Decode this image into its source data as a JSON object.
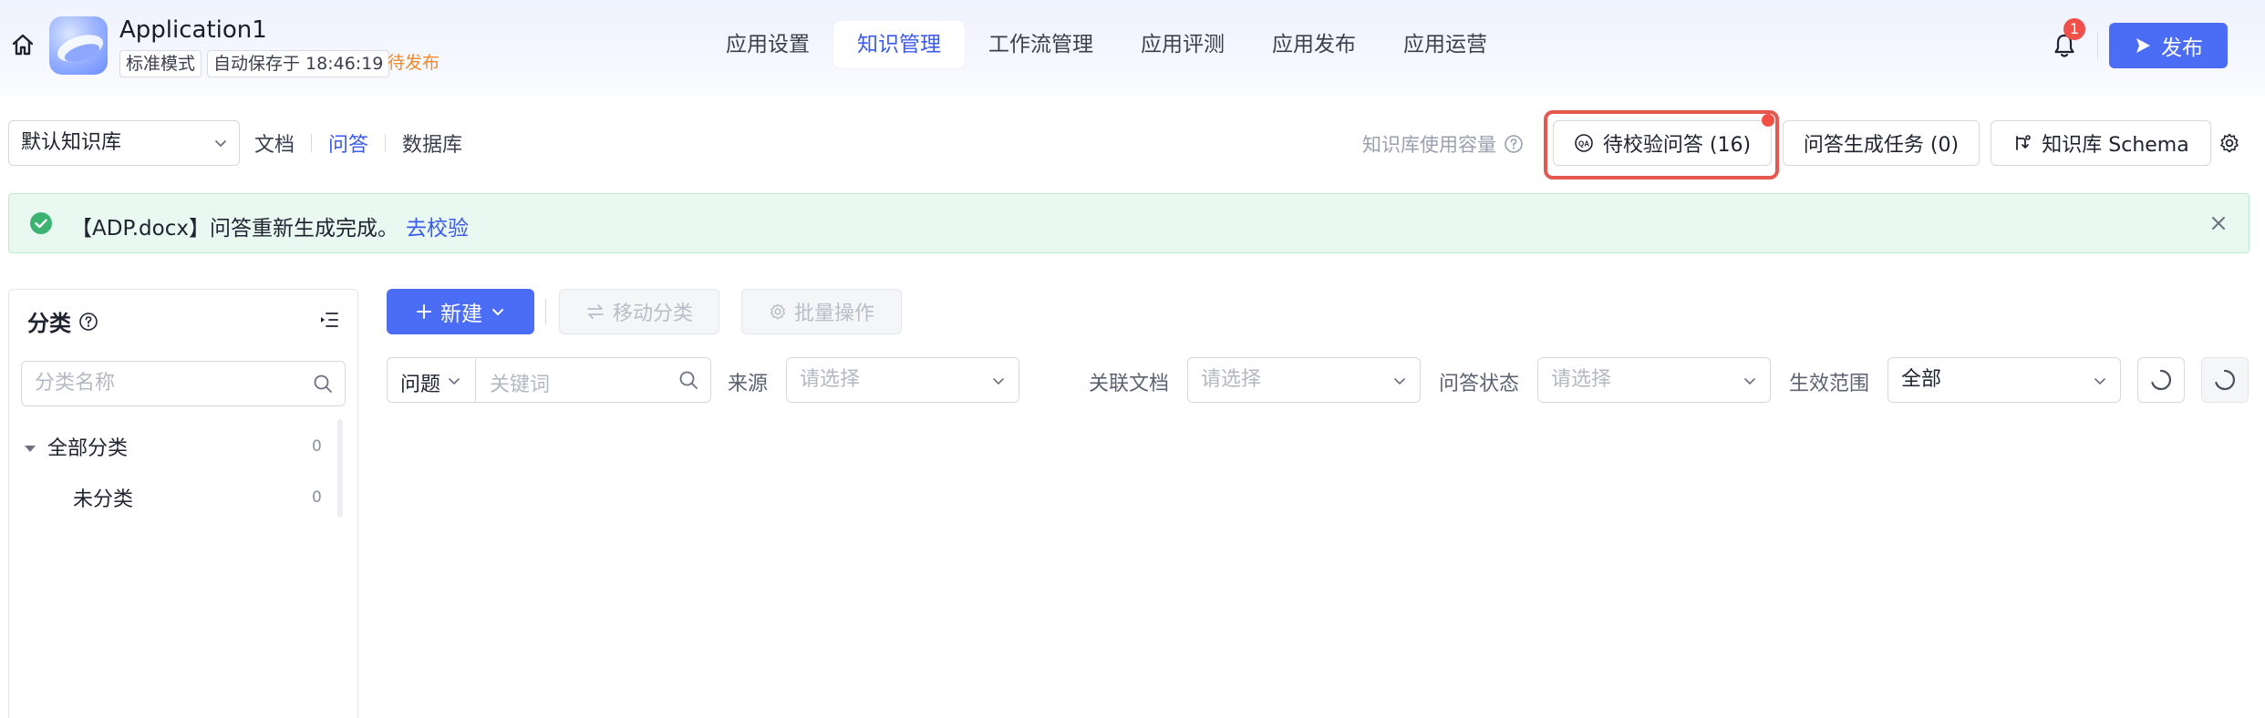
{
  "header": {
    "app_name": "Application1",
    "mode_tag": "标准模式",
    "autosave_tag": "自动保存于 18:46:19",
    "status_tag": "待发布",
    "tabs": [
      {
        "label": "应用设置",
        "active": false
      },
      {
        "label": "知识管理",
        "active": true
      },
      {
        "label": "工作流管理",
        "active": false
      },
      {
        "label": "应用评测",
        "active": false
      },
      {
        "label": "应用发布",
        "active": false
      },
      {
        "label": "应用运营",
        "active": false
      }
    ],
    "notification_count": "1",
    "publish_label": "发布"
  },
  "kb_bar": {
    "selected_kb": "默认知识库",
    "subtabs": [
      {
        "label": "文档",
        "active": false
      },
      {
        "label": "问答",
        "active": true
      },
      {
        "label": "数据库",
        "active": false
      }
    ],
    "capacity_label": "知识库使用容量",
    "pending_button": "待校验问答 (16)",
    "gen_task_button": "问答生成任务 (0)",
    "schema_button": "知识库 Schema"
  },
  "alert": {
    "message": "【ADP.docx】问答重新生成完成。",
    "link": "去校验"
  },
  "category": {
    "title": "分类",
    "search_placeholder": "分类名称",
    "tree": [
      {
        "label": "全部分类",
        "count": "0"
      },
      {
        "label": "未分类",
        "count": "0"
      }
    ]
  },
  "toolbar": {
    "new_label": "新建",
    "move_label": "移动分类",
    "batch_label": "批量操作"
  },
  "filters": {
    "type_value": "问题",
    "keyword_placeholder": "关键词",
    "source_label": "来源",
    "source_placeholder": "请选择",
    "doc_label": "关联文档",
    "doc_placeholder": "请选择",
    "status_label": "问答状态",
    "status_placeholder": "请选择",
    "scope_label": "生效范围",
    "scope_value": "全部"
  },
  "colors": {
    "primary": "#4b6cf5",
    "active_text": "#3a5af0",
    "pending_status": "#ee8a2d",
    "highlight": "#e5584f",
    "success": "#3cb371"
  }
}
